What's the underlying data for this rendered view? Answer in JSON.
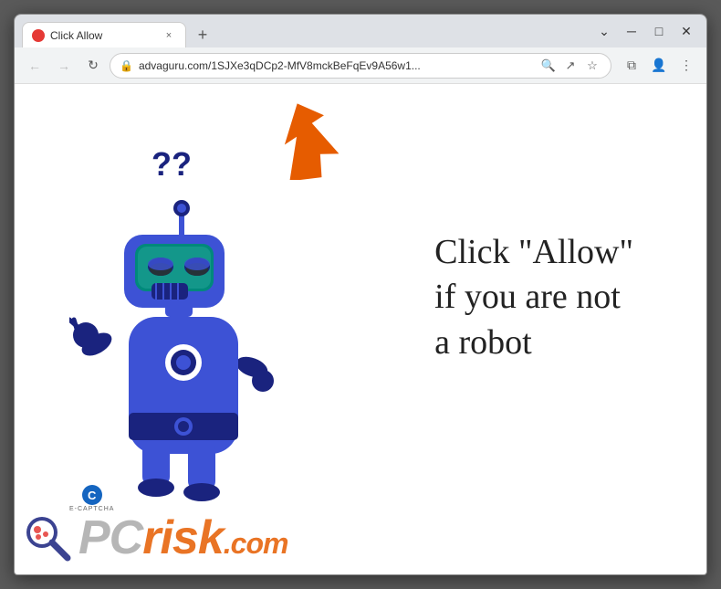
{
  "browser": {
    "tab": {
      "favicon_color": "#e53935",
      "title": "Click Allow",
      "close_label": "×"
    },
    "new_tab_label": "+",
    "window_controls": {
      "minimize": "─",
      "maximize": "□",
      "close": "✕"
    },
    "nav": {
      "back_label": "←",
      "forward_label": "→",
      "refresh_label": "↻",
      "url": "advaguru.com/1SJXe3qDCp2-MfV8mckBeFqEv9A56w1...",
      "search_label": "🔍",
      "share_label": "↗",
      "bookmark_label": "☆",
      "split_label": "⧉",
      "profile_label": "👤",
      "menu_label": "⋮"
    }
  },
  "page": {
    "arrow_color": "#e65c00",
    "question_marks": "??",
    "main_text_line1": "Click \"Allow\"",
    "main_text_line2": "if you are not",
    "main_text_line3": "a robot",
    "ecaptcha_letter": "C",
    "ecaptcha_label": "E-CAPTCHA",
    "pcrisk_pc": "PC",
    "pcrisk_risk": "risk",
    "pcrisk_dot": ".",
    "pcrisk_com": "com"
  },
  "robot": {
    "body_color": "#3d52d5",
    "dark_color": "#1a237e",
    "visor_color": "#00897b",
    "white": "#ffffff"
  }
}
